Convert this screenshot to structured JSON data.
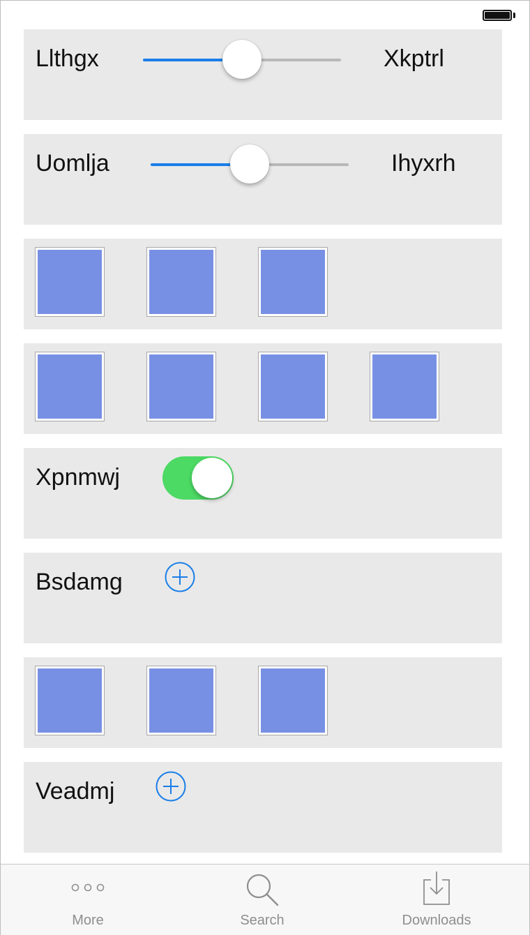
{
  "status_bar": {
    "battery_icon": "battery-full-icon"
  },
  "rows": {
    "slider1": {
      "left_label": "Llthgx",
      "right_label": "Xkptrl",
      "value": 0.5
    },
    "slider2": {
      "left_label": "Uomlja",
      "right_label": "Ihyxrh",
      "value": 0.5
    },
    "toggle_row": {
      "label": "Xpnmwj",
      "on": true
    },
    "add_row1": {
      "label": "Bsdamg",
      "icon": "plus-circle-icon"
    },
    "add_row2": {
      "label": "Veadmj",
      "icon": "plus-circle-icon"
    }
  },
  "colors": {
    "accent": "#1a7ee8",
    "toggle_on": "#4cd964",
    "square_fill": "#7890e4",
    "row_background": "#e9e9e9"
  },
  "tab_bar": {
    "tabs": [
      {
        "label": "More",
        "icon": "more-dots-icon"
      },
      {
        "label": "Search",
        "icon": "search-icon"
      },
      {
        "label": "Downloads",
        "icon": "download-tray-icon"
      }
    ]
  }
}
